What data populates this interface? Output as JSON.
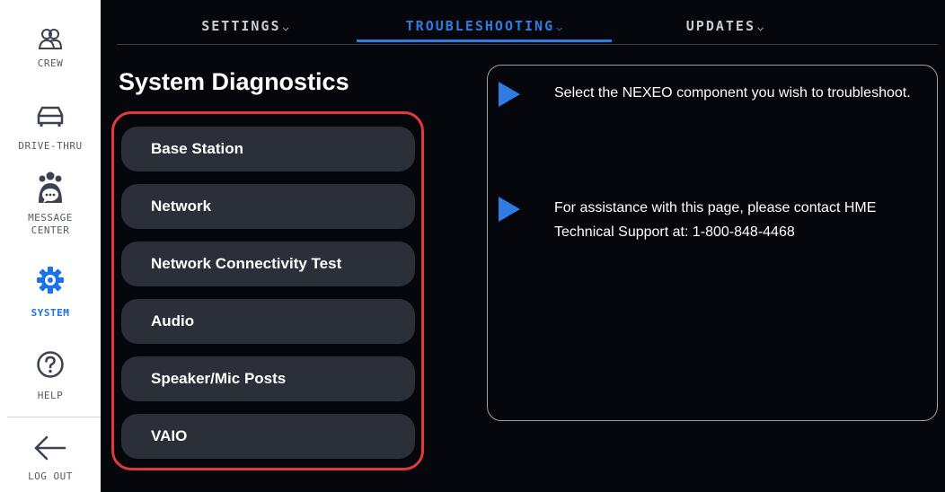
{
  "sidebar": {
    "items": [
      {
        "label": "CREW",
        "icon": "crew-icon"
      },
      {
        "label": "DRIVE-THRU",
        "icon": "car-icon"
      },
      {
        "label_line1": "MESSAGE",
        "label_line2": "CENTER",
        "icon": "message-center-icon"
      },
      {
        "label": "SYSTEM",
        "icon": "gear-icon",
        "active": true
      },
      {
        "label": "HELP",
        "icon": "help-icon"
      },
      {
        "label": "LOG OUT",
        "icon": "arrow-left-icon"
      }
    ]
  },
  "nav": {
    "tabs": [
      {
        "label": "SETTINGS"
      },
      {
        "label": "TROUBLESHOOTING",
        "active": true
      },
      {
        "label": "UPDATES"
      }
    ],
    "chevron": "⌄"
  },
  "page": {
    "title": "System Diagnostics"
  },
  "diagnostics": {
    "buttons": [
      {
        "label": "Base Station"
      },
      {
        "label": "Network"
      },
      {
        "label": "Network Connectivity Test"
      },
      {
        "label": "Audio"
      },
      {
        "label": "Speaker/Mic Posts"
      },
      {
        "label": "VAIO"
      }
    ]
  },
  "info": {
    "items": [
      {
        "text": "Select the NEXEO component you wish to troubleshoot."
      },
      {
        "text": "For assistance with this page, please contact HME Technical Support at: 1-800-848-4468"
      }
    ]
  },
  "colors": {
    "accent": "#2f7de1",
    "highlight_border": "#e03a3a",
    "button_bg": "#2a2f38",
    "background": "#05070d"
  }
}
